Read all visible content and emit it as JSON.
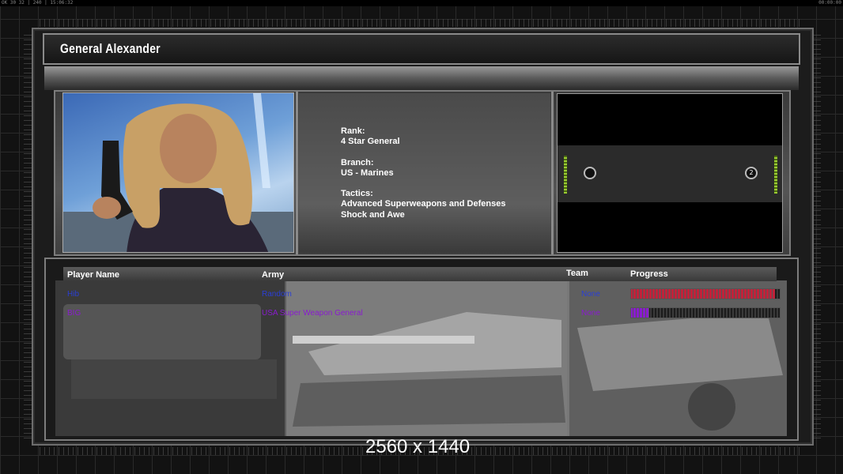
{
  "topbar": {
    "left": "OK 30 32 | 240 | 15:06:32",
    "right": "00:00:00"
  },
  "general": {
    "name": "General Alexander"
  },
  "info": {
    "rank_label": "Rank:",
    "rank_value": "4 Star General",
    "branch_label": "Branch:",
    "branch_value": "US - Marines",
    "tactics_label": "Tactics:",
    "tactics_lines": [
      "Advanced Superweapons and Defenses",
      "Shock and Awe"
    ]
  },
  "map": {
    "start_positions": [
      "",
      "2"
    ]
  },
  "table": {
    "headers": {
      "player": "Player Name",
      "army": "Army",
      "team": "Team",
      "progress": "Progress"
    },
    "rows": [
      {
        "player": "Hib",
        "army": "Random",
        "team": "None",
        "progress": 0.97,
        "player_color": "#2a3fd6",
        "bar_color": "#c0223a"
      },
      {
        "player": "BIG",
        "army": "USA Super Weapon General",
        "team": "None",
        "progress": 0.12,
        "player_color": "#8a1bd0",
        "bar_color": "#8a1bd0"
      }
    ]
  },
  "resolution": "2560 x 1440"
}
